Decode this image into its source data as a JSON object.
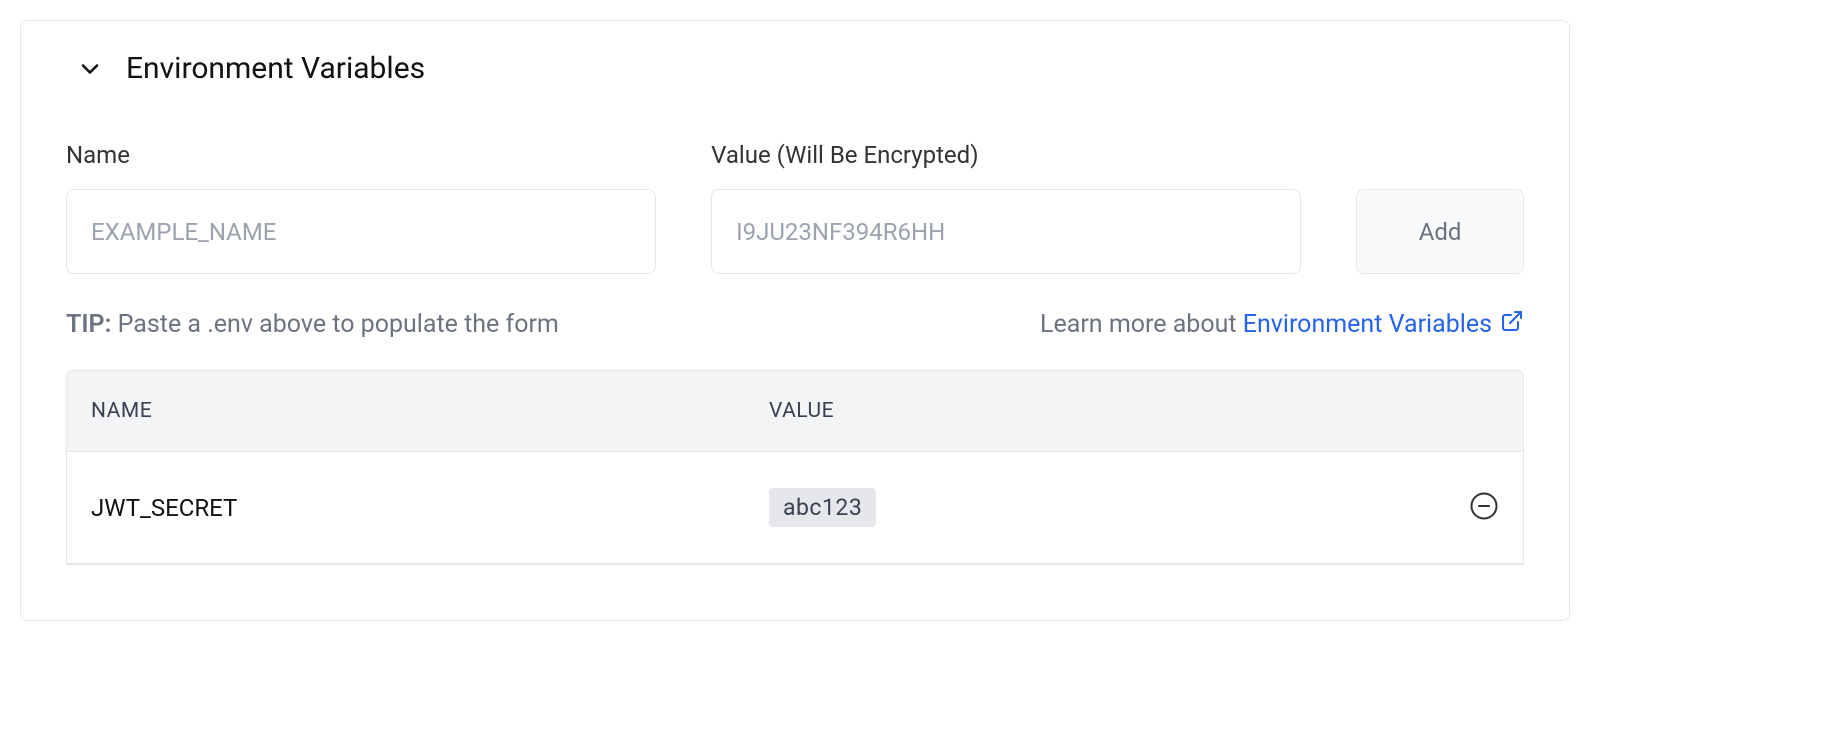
{
  "panel": {
    "title": "Environment Variables"
  },
  "form": {
    "name_label": "Name",
    "name_placeholder": "EXAMPLE_NAME",
    "value_label": "Value (Will Be Encrypted)",
    "value_placeholder": "I9JU23NF394R6HH",
    "add_button_label": "Add"
  },
  "tip": {
    "label": "TIP:",
    "text": " Paste a .env above to populate the form",
    "learn_more_prefix": "Learn more about ",
    "learn_more_link": "Environment Variables"
  },
  "table": {
    "headers": {
      "name": "NAME",
      "value": "VALUE"
    },
    "rows": [
      {
        "name": "JWT_SECRET",
        "value": "abc123"
      }
    ]
  }
}
